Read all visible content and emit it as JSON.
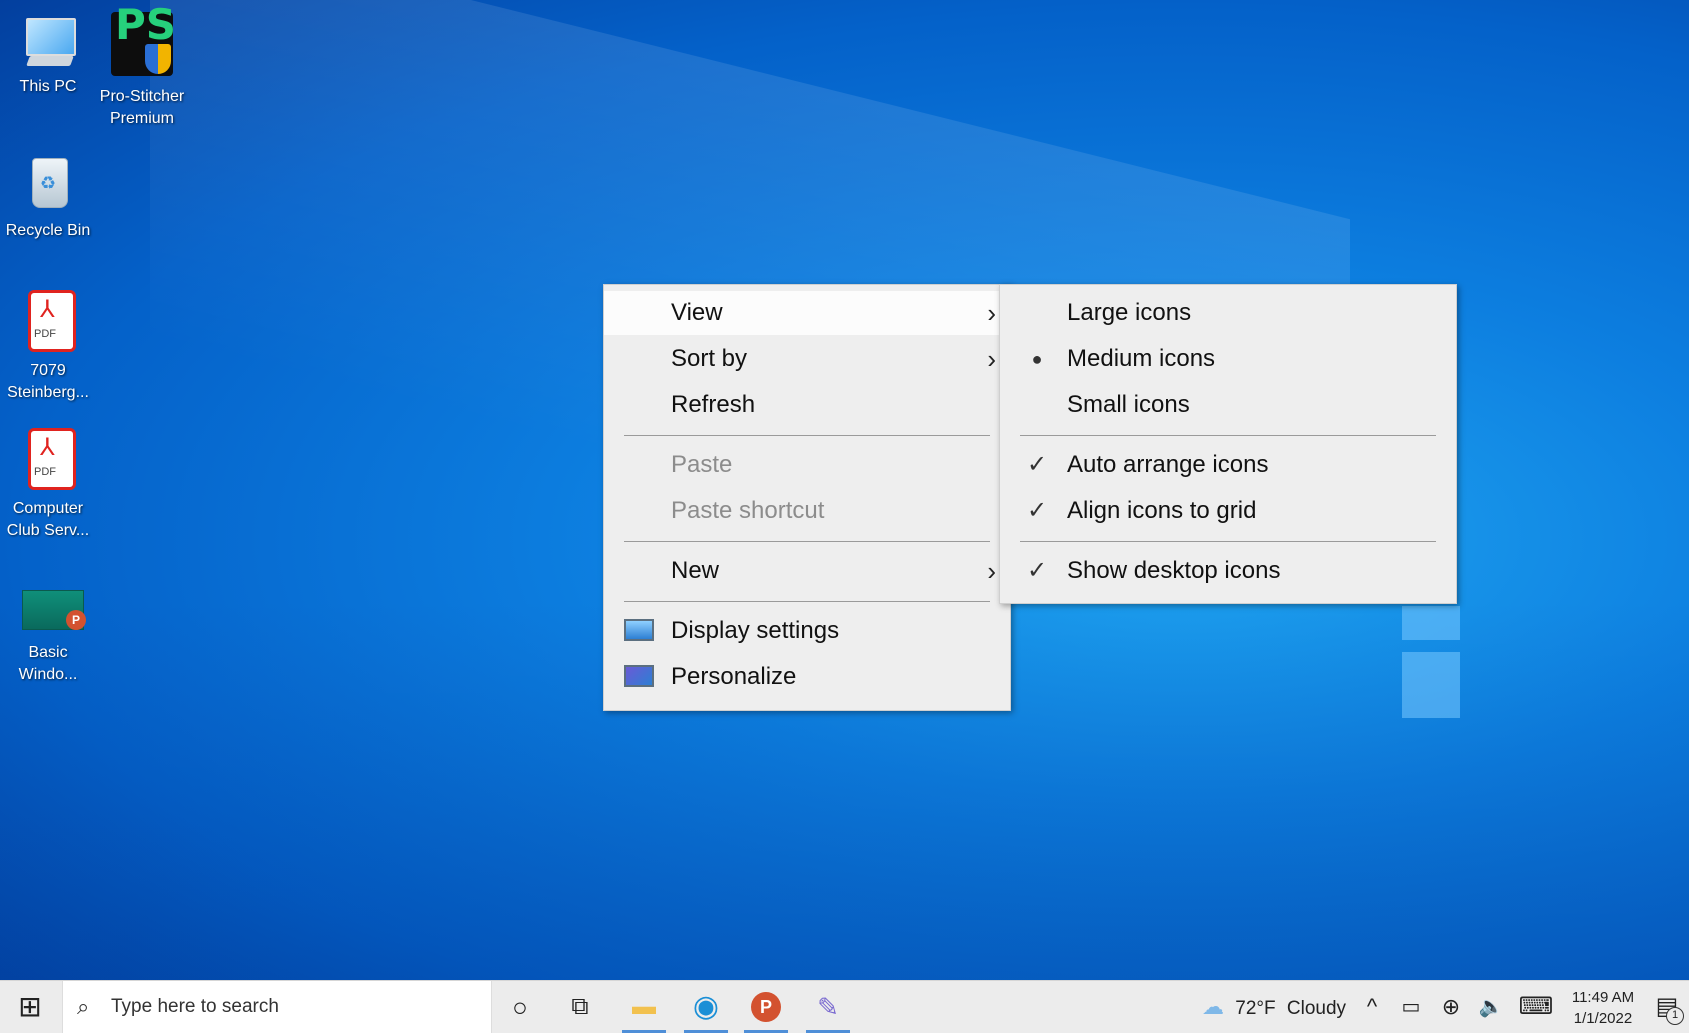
{
  "desktop": {
    "icons": [
      {
        "label": "This PC"
      },
      {
        "label": "Pro-Stitcher Premium",
        "badge_text": "PS"
      },
      {
        "label": "Recycle Bin"
      },
      {
        "label": "7079 Steinberg...",
        "badge_text": "PDF"
      },
      {
        "label": "Computer Club Serv...",
        "badge_text": "PDF"
      },
      {
        "label": "Basic Windo...",
        "badge_text": "P"
      }
    ]
  },
  "context_menu": {
    "items": [
      {
        "label": "View",
        "has_submenu": true,
        "highlighted": true
      },
      {
        "label": "Sort by",
        "has_submenu": true
      },
      {
        "label": "Refresh"
      },
      {
        "label": "Paste",
        "disabled": true
      },
      {
        "label": "Paste shortcut",
        "disabled": true
      },
      {
        "label": "New",
        "has_submenu": true
      },
      {
        "label": "Display settings",
        "icon": "display-settings-icon"
      },
      {
        "label": "Personalize",
        "icon": "personalize-icon"
      }
    ],
    "arrow_glyph": "›"
  },
  "view_submenu": {
    "items": [
      {
        "label": "Large icons"
      },
      {
        "label": "Medium icons",
        "mark": "●",
        "selected": true
      },
      {
        "label": "Small icons"
      },
      {
        "label": "Auto arrange icons",
        "mark": "✓",
        "checked": true
      },
      {
        "label": "Align icons to grid",
        "mark": "✓",
        "checked": true
      },
      {
        "label": "Show desktop icons",
        "mark": "✓",
        "checked": true
      }
    ]
  },
  "taskbar": {
    "start_glyph": "⊞",
    "search_placeholder": "Type here to search",
    "search_glyph": "⌕",
    "cortana_glyph": "○",
    "taskview_glyph": "⧉",
    "apps": [
      {
        "name": "file-explorer-icon",
        "glyph": "▬",
        "color": "#f2c14e"
      },
      {
        "name": "edge-icon",
        "glyph": "◉",
        "color": "#1b8fd6"
      },
      {
        "name": "powerpoint-icon",
        "glyph": "P",
        "color": "#d35230"
      },
      {
        "name": "paint-icon",
        "glyph": "✎",
        "color": "#7a6ad0"
      }
    ],
    "weather": {
      "temp": "72°F",
      "condition": "Cloudy",
      "glyph": "☁"
    },
    "tray": {
      "chevron_glyph": "^",
      "battery_glyph": "▭",
      "network_glyph": "⊕",
      "volume_glyph": "🔈",
      "keyboard_glyph": "⌨"
    },
    "clock": {
      "time": "11:49 AM",
      "date": "1/1/2022"
    },
    "notification_glyph": "▤",
    "notification_count": "1"
  }
}
